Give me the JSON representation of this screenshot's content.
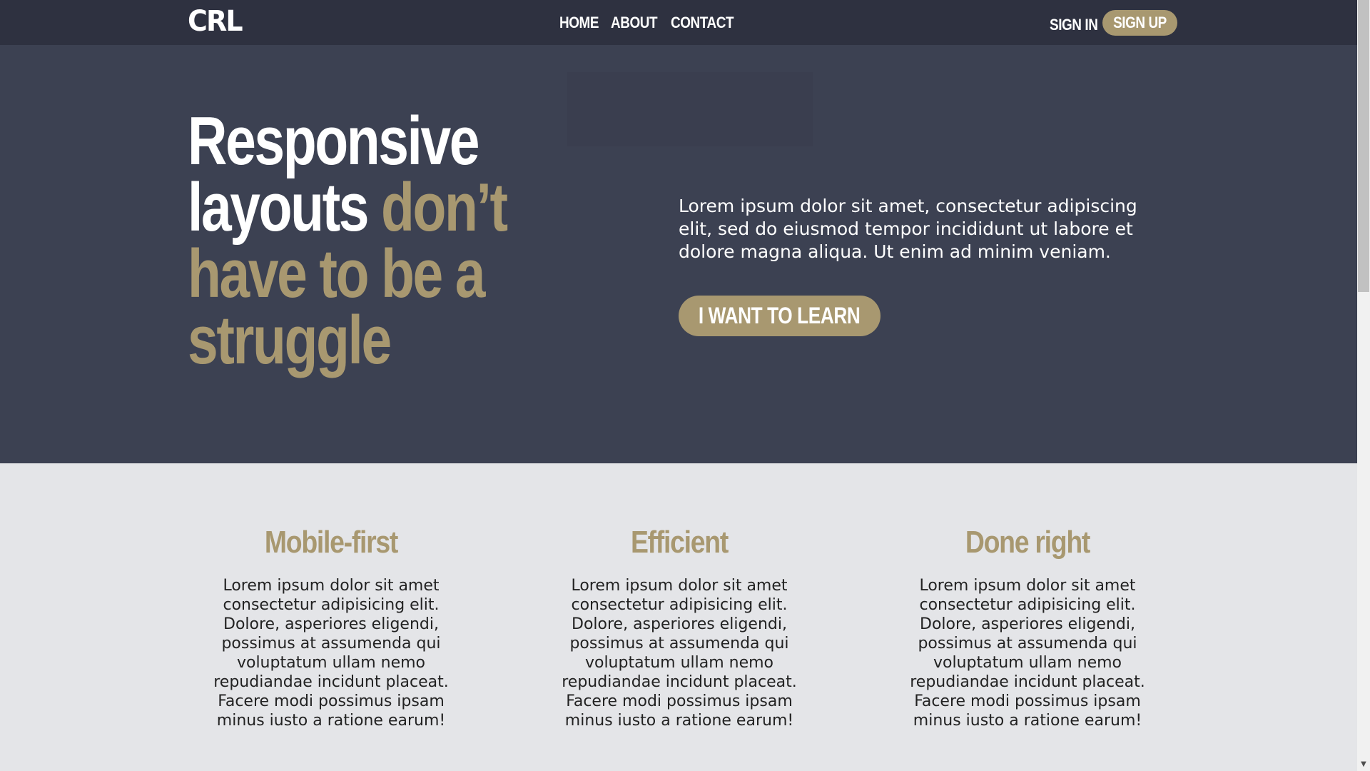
{
  "header": {
    "logo": "CRL",
    "nav": [
      "HOME",
      "ABOUT",
      "CONTACT"
    ],
    "sign_in": "SIGN IN",
    "sign_up": "SIGN UP"
  },
  "hero": {
    "title_white": "Responsive layouts",
    "title_accent": "don’t have to be a struggle",
    "text": "Lorem ipsum dolor sit amet, consectetur adipiscing elit, sed do eiusmod tempor incididunt ut labore et dolore magna aliqua. Ut enim ad minim veniam.",
    "cta": "I WANT TO LEARN"
  },
  "features": [
    {
      "title": "Mobile-first",
      "text": "Lorem ipsum dolor sit amet consectetur adipisicing elit. Dolore, asperiores eligendi, possimus at assumenda qui voluptatum ullam nemo repudiandae incidunt placeat. Facere modi possimus ipsam minus iusto a ratione earum!"
    },
    {
      "title": "Efficient",
      "text": "Lorem ipsum dolor sit amet consectetur adipisicing elit. Dolore, asperiores eligendi, possimus at assumenda qui voluptatum ullam nemo repudiandae incidunt placeat. Facere modi possimus ipsam minus iusto a ratione earum!"
    },
    {
      "title": "Done right",
      "text": "Lorem ipsum dolor sit amet consectetur adipisicing elit. Dolore, asperiores eligendi, possimus at assumenda qui voluptatum ullam nemo repudiandae incidunt placeat. Facere modi possimus ipsam minus iusto a ratione earum!"
    }
  ],
  "colors": {
    "header_bg": "#2e3140",
    "hero_bg": "#3c4152",
    "accent": "#a89870",
    "section_bg": "#e4e5e8"
  },
  "icons": {
    "scroll_down": "chevron-down-icon"
  }
}
